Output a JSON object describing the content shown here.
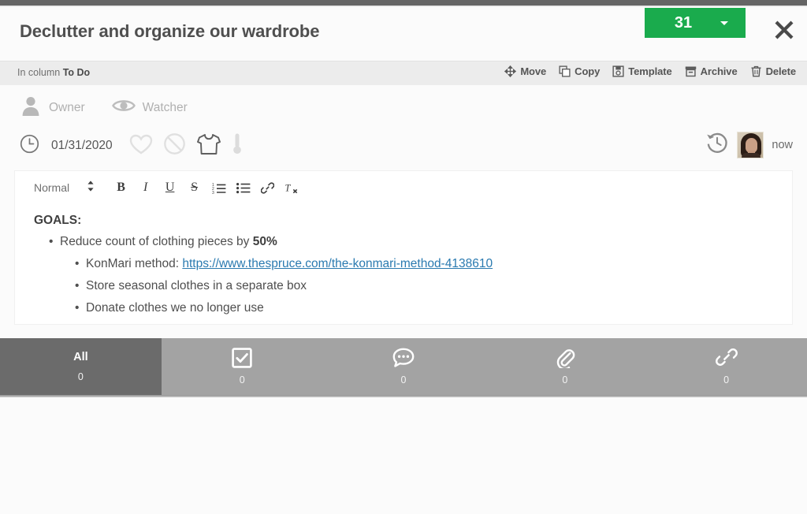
{
  "header": {
    "title": "Declutter and organize our wardrobe",
    "badge_count": "31",
    "badge_color": "#1aab4d",
    "close_label": "Close"
  },
  "subheader": {
    "in_column_prefix": "In column",
    "column_name": "To Do",
    "actions": [
      {
        "label": "Move",
        "icon": "move-icon"
      },
      {
        "label": "Copy",
        "icon": "copy-icon"
      },
      {
        "label": "Template",
        "icon": "template-icon"
      },
      {
        "label": "Archive",
        "icon": "archive-icon"
      },
      {
        "label": "Delete",
        "icon": "trash-icon"
      }
    ]
  },
  "meta": {
    "owner_label": "Owner",
    "watcher_label": "Watcher",
    "due_date": "01/31/2020",
    "badges": [
      {
        "name": "heart-icon"
      },
      {
        "name": "block-icon"
      },
      {
        "name": "tshirt-icon"
      },
      {
        "name": "thermometer-icon"
      }
    ],
    "last_updated": "now"
  },
  "editor": {
    "format_label": "Normal",
    "toolbar": [
      {
        "name": "bold-button",
        "glyph": "B"
      },
      {
        "name": "italic-button",
        "glyph": "I"
      },
      {
        "name": "underline-button",
        "glyph": "U"
      },
      {
        "name": "strikethrough-button",
        "glyph": "S"
      },
      {
        "name": "ordered-list-button",
        "glyph": "1."
      },
      {
        "name": "bullet-list-button",
        "glyph": "≡"
      },
      {
        "name": "link-button",
        "glyph": "🔗"
      },
      {
        "name": "clear-format-button",
        "glyph": "Tx"
      }
    ],
    "content": {
      "heading": "GOALS:",
      "bullet1_text": "Reduce count of clothing pieces by ",
      "bullet1_bold": "50%",
      "bullet2_prefix": "KonMari method: ",
      "bullet2_link": "https://www.thespruce.com/the-konmari-method-4138610",
      "bullet3": "Store seasonal clothes in a separate box",
      "bullet4": "Donate clothes we no longer use"
    }
  },
  "tabs": [
    {
      "label": "All",
      "icon": "",
      "count": "0",
      "active": true
    },
    {
      "label": "",
      "icon": "checkbox-icon",
      "count": "0",
      "active": false
    },
    {
      "label": "",
      "icon": "comment-icon",
      "count": "0",
      "active": false
    },
    {
      "label": "",
      "icon": "paperclip-icon",
      "count": "0",
      "active": false
    },
    {
      "label": "",
      "icon": "link-chain-icon",
      "count": "0",
      "active": false
    }
  ]
}
